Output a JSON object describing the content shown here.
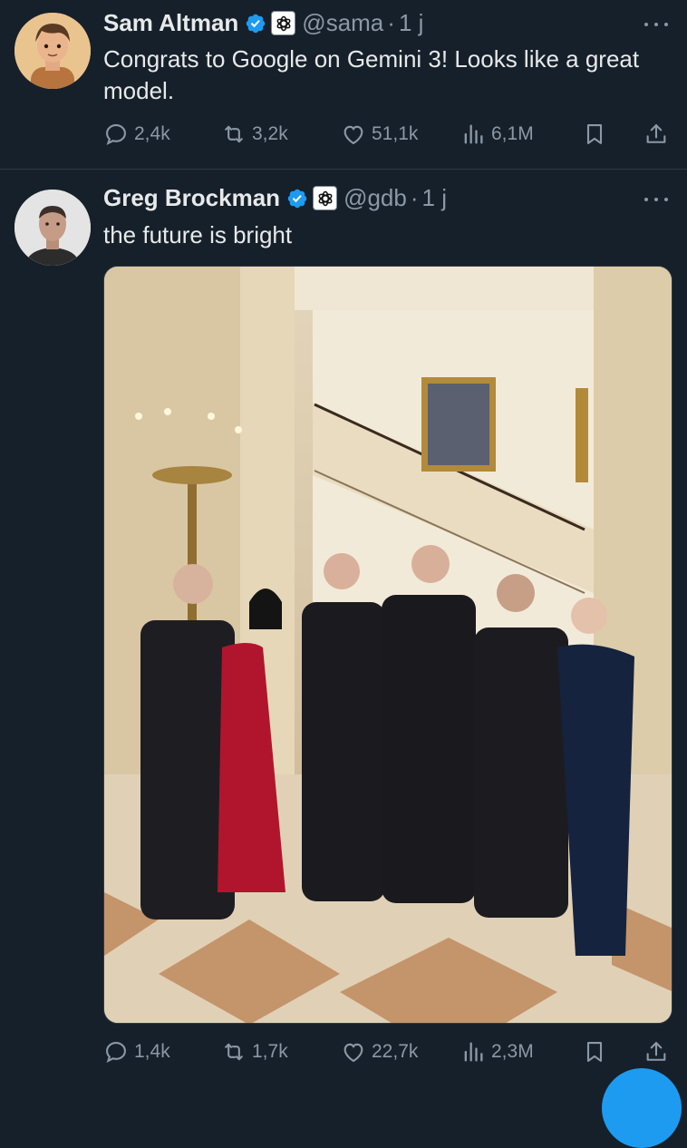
{
  "colors": {
    "background": "#16202a",
    "text_primary": "#e7e9ea",
    "text_secondary": "#8b98a5",
    "verified": "#1d9bf0",
    "accent": "#1d9bf0"
  },
  "tweets": [
    {
      "author_name": "Sam Altman",
      "handle": "@sama",
      "time": "1 j",
      "verified": true,
      "affiliate_badge": "openai-logo-icon",
      "text": "Congrats to Google on Gemini 3! Looks like a great model.",
      "replies": "2,4k",
      "reposts": "3,2k",
      "likes": "51,1k",
      "views": "6,1M"
    },
    {
      "author_name": "Greg Brockman",
      "handle": "@gdb",
      "time": "1 j",
      "verified": true,
      "affiliate_badge": "openai-logo-icon",
      "text": "the future is bright",
      "media": "photo",
      "replies": "1,4k",
      "reposts": "1,7k",
      "likes": "22,7k",
      "views": "2,3M"
    }
  ],
  "separator": "·"
}
